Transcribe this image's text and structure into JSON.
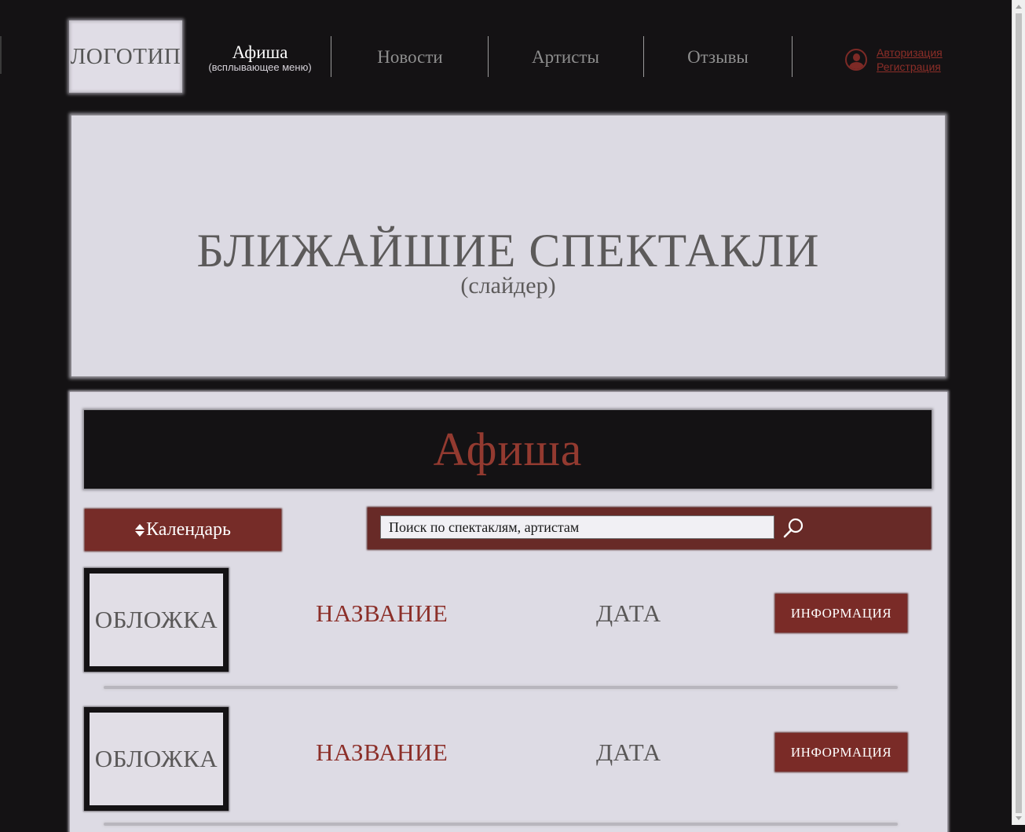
{
  "header": {
    "logo_label": "ЛОГОТИП",
    "nav": [
      {
        "label": "Афиша",
        "sub": "(всплывающее меню)"
      },
      {
        "label": "Новости"
      },
      {
        "label": "Артисты"
      },
      {
        "label": "Отзывы"
      }
    ],
    "auth": {
      "login": "Авторизация",
      "register": "Регистрация"
    }
  },
  "slider": {
    "title": "БЛИЖАЙШИЕ СПЕКТАКЛИ",
    "subtitle": "(слайдер)"
  },
  "afisha": {
    "heading": "Афиша",
    "calendar_label": "Календарь",
    "search_placeholder": "Поиск по спектаклям, артистам",
    "items": [
      {
        "cover": "ОБЛОЖКА",
        "title": "НАЗВАНИЕ",
        "date": "ДАТА",
        "button": "ИНФОРМАЦИЯ"
      },
      {
        "cover": "ОБЛОЖКА",
        "title": "НАЗВАНИЕ",
        "date": "ДАТА",
        "button": "ИНФОРМАЦИЯ"
      }
    ]
  },
  "colors": {
    "background": "#141214",
    "accent": "#7a2b27",
    "panel": "#dddbe4",
    "link": "#8c2e28"
  },
  "icons": {
    "user": "user-icon",
    "search": "search-icon",
    "sort": "sort-icon"
  }
}
